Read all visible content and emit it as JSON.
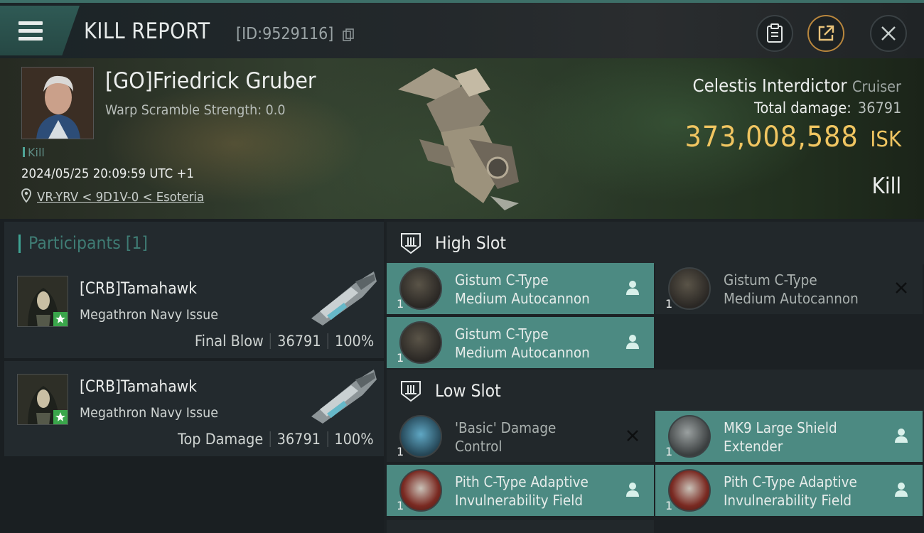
{
  "header": {
    "title": "KILL REPORT",
    "report_id": "[ID:9529116]"
  },
  "victim": {
    "name": "[GO]Friedrick Gruber",
    "warp_scramble": "Warp Scramble Strength: 0.0",
    "tag": "Kill",
    "timestamp": "2024/05/25 20:09:59 UTC +1",
    "location": "VR-YRV < 9D1V-0 < Esoteria",
    "ship_name": "Celestis Interdictor",
    "ship_class": "Cruiser",
    "total_damage_label": "Total damage:",
    "total_damage": "36791",
    "isk_value": "373,008,588",
    "isk_unit": "ISK",
    "result": "Kill"
  },
  "participants": {
    "title": "Participants [1]",
    "items": [
      {
        "name": "[CRB]Tamahawk",
        "ship": "Megathron Navy Issue",
        "role": "Final Blow",
        "damage": "36791",
        "percent": "100%"
      },
      {
        "name": "[CRB]Tamahawk",
        "ship": "Megathron Navy Issue",
        "role": "Top Damage",
        "damage": "36791",
        "percent": "100%"
      }
    ]
  },
  "fitting": {
    "high_slot_title": "High Slot",
    "low_slot_title": "Low Slot",
    "high": [
      {
        "line1": "Gistum C-Type",
        "line2": "Medium Autocannon",
        "qty": "1",
        "state": "user-icon"
      },
      {
        "line1": "Gistum C-Type",
        "line2": "Medium Autocannon",
        "qty": "1",
        "state": "close-icon"
      },
      {
        "line1": "Gistum C-Type",
        "line2": "Medium Autocannon",
        "qty": "1",
        "state": "user-icon"
      }
    ],
    "low": [
      {
        "line1": "'Basic' Damage",
        "line2": "Control",
        "qty": "1",
        "state": "close-icon"
      },
      {
        "line1": "MK9 Large Shield",
        "line2": "Extender",
        "qty": "1",
        "state": "user-icon"
      },
      {
        "line1": "Pith C-Type Adaptive",
        "line2": "Invulnerability Field",
        "qty": "1",
        "state": "user-icon"
      },
      {
        "line1": "Pith C-Type Adaptive",
        "line2": "Invulnerability Field",
        "qty": "1",
        "state": "user-icon"
      }
    ]
  },
  "colors": {
    "accent_teal": "#4c8a82",
    "isk_gold": "#f0c561",
    "kill_tag": "#4fa597"
  }
}
